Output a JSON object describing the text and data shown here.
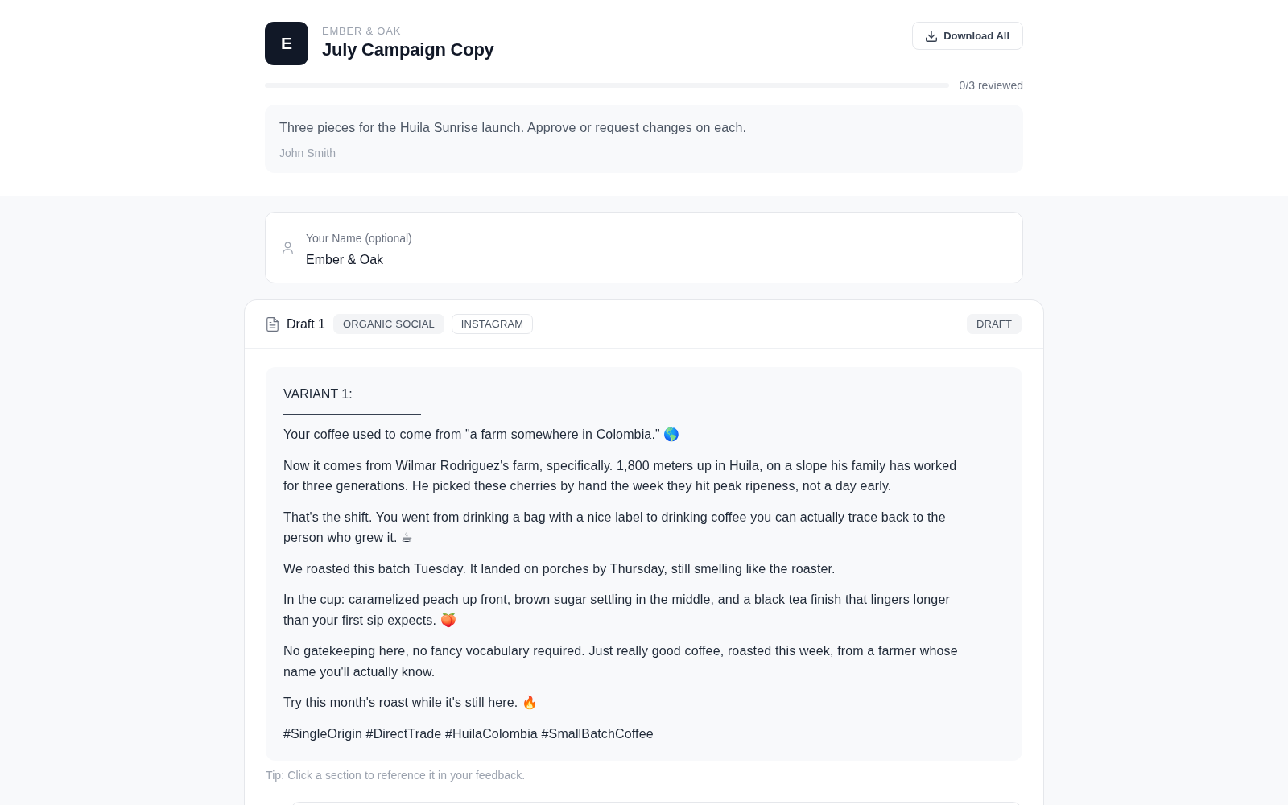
{
  "header": {
    "logo_letter": "E",
    "brand": "EMBER & OAK",
    "title": "July Campaign Copy",
    "download_button": "Download All"
  },
  "progress": {
    "label": "0/3 reviewed"
  },
  "brief": {
    "message": "Three pieces for the Huila Sunrise launch. Approve or request changes on each.",
    "author": "John Smith"
  },
  "name_field": {
    "label": "Your Name (optional)",
    "value": "Ember & Oak"
  },
  "drafts": [
    {
      "title": "Draft 1",
      "tags": [
        {
          "label": "ORGANIC SOCIAL",
          "kind": "filled"
        },
        {
          "label": "INSTAGRAM",
          "kind": "outlined"
        }
      ],
      "status": "DRAFT",
      "variants": [
        {
          "heading": "VARIANT 1:",
          "paragraphs": [
            "Your coffee used to come from \"a farm somewhere in Colombia.\" 🌎",
            "Now it comes from Wilmar Rodriguez's farm, specifically. 1,800 meters up in Huila, on a slope his family has worked for three generations. He picked these cherries by hand the week they hit peak ripeness, not a day early.",
            "That's the shift. You went from drinking a bag with a nice label to drinking coffee you can actually trace back to the person who grew it. ☕",
            "We roasted this batch Tuesday. It landed on porches by Thursday, still smelling like the roaster.",
            "In the cup: caramelized peach up front, brown sugar settling in the middle, and a black tea finish that lingers longer than your first sip expects. 🍑",
            "No gatekeeping here, no fancy vocabulary required. Just really good coffee, roasted this week, from a farmer whose name you'll actually know.",
            "Try this month's roast while it's still here. 🔥",
            "#SingleOrigin #DirectTrade #HuilaColombia #SmallBatchCoffee"
          ]
        }
      ],
      "tip": "Tip: Click a section to reference it in your feedback."
    }
  ]
}
